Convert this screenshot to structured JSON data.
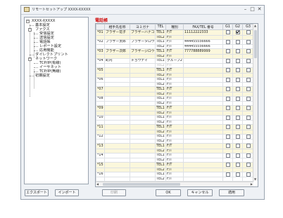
{
  "window": {
    "title": "リモートセットアップ   XXXX-XXXXX",
    "minimize": "–",
    "maximize": "□",
    "close": "✕"
  },
  "tree": [
    {
      "label": "XXXX-XXXXX",
      "icon": "minus"
    },
    {
      "label": "基本設定"
    },
    {
      "label": "ファクス",
      "icon": "minus"
    },
    {
      "label": "受信設定"
    },
    {
      "label": "送信設定"
    },
    {
      "label": "電話帳"
    },
    {
      "label": "レポート設定"
    },
    {
      "label": "応用機能"
    },
    {
      "label": "ダイレクトプリント"
    },
    {
      "label": "ネットワーク",
      "icon": "minus"
    },
    {
      "label": "TCP/IP(有線)"
    },
    {
      "label": "イーサネット"
    },
    {
      "label": "TCP/IP(無線)"
    },
    {
      "label": "初期設定"
    }
  ],
  "section_label": "電話帳",
  "table": {
    "headers": [
      "",
      "相手先名称",
      "ヨミガナ",
      "TEL",
      "種別",
      "FAX/TEL 番号",
      "G1",
      "G2",
      "G3"
    ],
    "rows": [
      {
        "num": "*01",
        "name": "ブラザー花子",
        "yomi": "ブラザーハナコ",
        "tel": "TEL1",
        "kind": "F/T",
        "number": "11112222333"
      },
      {
        "num": "*01",
        "name": "",
        "yomi": "",
        "tel": "TEL2",
        "kind": "F/T",
        "number": ""
      },
      {
        "num": "*02",
        "name": "ブラザー太郎",
        "yomi": "ブラザータロウ",
        "tel": "TEL1",
        "kind": "F/T",
        "number": "444455556666"
      },
      {
        "num": "*02",
        "name": "",
        "yomi": "",
        "tel": "TEL2",
        "kind": "F/T",
        "number": "444455556666"
      },
      {
        "num": "*03",
        "name": "ブラザー次郎",
        "yomi": "ブラザージロウ",
        "tel": "TEL1",
        "kind": "F/T",
        "number": "777788889999"
      },
      {
        "num": "*03",
        "name": "",
        "yomi": "",
        "tel": "TEL2",
        "kind": "F/T",
        "number": ""
      },
      {
        "num": "*04",
        "name": "町内",
        "yomi": "チョウナイ",
        "tel": "TEL1",
        "kind": "グループ2",
        "number": ""
      },
      {
        "num": "*04",
        "name": "",
        "yomi": "",
        "tel": "TEL2",
        "kind": "F/T",
        "number": "",
        "dim": true
      },
      {
        "num": "*05",
        "name": "",
        "yomi": "",
        "tel": "TEL1",
        "kind": "F/T",
        "number": ""
      },
      {
        "num": "*05",
        "name": "",
        "yomi": "",
        "tel": "TEL2",
        "kind": "F/T",
        "number": ""
      },
      {
        "num": "*06",
        "name": "",
        "yomi": "",
        "tel": "TEL1",
        "kind": "F/T",
        "number": ""
      },
      {
        "num": "*06",
        "name": "",
        "yomi": "",
        "tel": "TEL2",
        "kind": "F/T",
        "number": ""
      },
      {
        "num": "*07",
        "name": "",
        "yomi": "",
        "tel": "TEL1",
        "kind": "F/T",
        "number": ""
      },
      {
        "num": "*07",
        "name": "",
        "yomi": "",
        "tel": "TEL2",
        "kind": "F/T",
        "number": ""
      },
      {
        "num": "*08",
        "name": "",
        "yomi": "",
        "tel": "TEL1",
        "kind": "F/T",
        "number": ""
      },
      {
        "num": "*08",
        "name": "",
        "yomi": "",
        "tel": "TEL2",
        "kind": "F/T",
        "number": ""
      },
      {
        "num": "*09",
        "name": "",
        "yomi": "",
        "tel": "TEL1",
        "kind": "F/T",
        "number": ""
      },
      {
        "num": "*09",
        "name": "",
        "yomi": "",
        "tel": "TEL2",
        "kind": "F/T",
        "number": ""
      },
      {
        "num": "*10",
        "name": "",
        "yomi": "",
        "tel": "TEL1",
        "kind": "F/T",
        "number": ""
      },
      {
        "num": "*10",
        "name": "",
        "yomi": "",
        "tel": "TEL2",
        "kind": "F/T",
        "number": ""
      },
      {
        "num": "*11",
        "name": "",
        "yomi": "",
        "tel": "TEL1",
        "kind": "F/T",
        "number": ""
      },
      {
        "num": "*11",
        "name": "",
        "yomi": "",
        "tel": "TEL2",
        "kind": "F/T",
        "number": ""
      },
      {
        "num": "*12",
        "name": "",
        "yomi": "",
        "tel": "TEL1",
        "kind": "F/T",
        "number": ""
      },
      {
        "num": "*12",
        "name": "",
        "yomi": "",
        "tel": "TEL2",
        "kind": "F/T",
        "number": ""
      },
      {
        "num": "*13",
        "name": "",
        "yomi": "",
        "tel": "TEL1",
        "kind": "F/T",
        "number": ""
      },
      {
        "num": "*13",
        "name": "",
        "yomi": "",
        "tel": "TEL2",
        "kind": "F/T",
        "number": ""
      },
      {
        "num": "*14",
        "name": "",
        "yomi": "",
        "tel": "TEL1",
        "kind": "F/T",
        "number": ""
      },
      {
        "num": "*14",
        "name": "",
        "yomi": "",
        "tel": "TEL2",
        "kind": "F/T",
        "number": ""
      },
      {
        "num": "*15",
        "name": "",
        "yomi": "",
        "tel": "TEL1",
        "kind": "F/T",
        "number": ""
      },
      {
        "num": "*15",
        "name": "",
        "yomi": "",
        "tel": "TEL2",
        "kind": "F/T",
        "number": ""
      },
      {
        "num": "*16",
        "name": "",
        "yomi": "",
        "tel": "TEL1",
        "kind": "F/T",
        "number": ""
      },
      {
        "num": "*16",
        "name": "",
        "yomi": "",
        "tel": "TEL2",
        "kind": "F/T",
        "number": ""
      }
    ],
    "checked_g2_rows": [
      0
    ]
  },
  "buttons": {
    "export": "エクスポート",
    "import": "インポート",
    "print": "印刷",
    "ok": "OK",
    "cancel": "キャンセル",
    "apply": "適用"
  },
  "colors": {
    "section_label": "#d01010",
    "row_yellow": "#fbf7dc"
  }
}
